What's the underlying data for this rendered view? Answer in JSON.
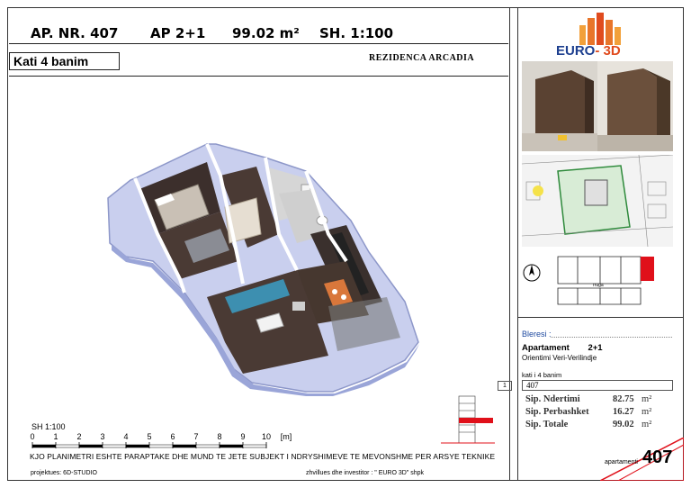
{
  "header": {
    "apartment_no": "AP. NR. 407",
    "type": "AP 2+1",
    "area": "99.02 m²",
    "scale": "SH. 1:100"
  },
  "floor_label": "Kati 4 banim",
  "residence_name": "REZIDENCA ARCADIA",
  "scale_bar": {
    "label": "SH 1:100",
    "ticks": [
      "0",
      "1",
      "2",
      "3",
      "4",
      "5",
      "6",
      "7",
      "8",
      "9",
      "10"
    ],
    "unit": "[m]"
  },
  "disclaimer": "KJO PLANIMETRI ESHTE PARAPTAKE DHE MUND TE JETE SUBJEKT I NDRYSHIMEVE TE MEVONSHME PER ARSYE TEKNIKE",
  "footer": {
    "project": "projektues:  6D-STUDIO",
    "investor": "zhvillues dhe investitor :  \" EURO 3D\" shpk"
  },
  "logo": {
    "part1": "EURO",
    "part2": "- 3D"
  },
  "site_plan_label": "rruga",
  "info": {
    "buyer_label": "Bleresi :",
    "apartment_label": "Apartament",
    "apartment_type": "2+1",
    "orientation": "Orientimi  Veri-Verilindje",
    "floor": "kati i 4 banim",
    "unit_box": "407",
    "small_box": "1",
    "areas": [
      {
        "label": "Sip. Ndertimi",
        "value": "82.75",
        "unit": "m²"
      },
      {
        "label": "Sip. Perbashket",
        "value": "16.27",
        "unit": "m²"
      },
      {
        "label": "Sip. Totale",
        "value": "99.02",
        "unit": "m²"
      }
    ],
    "apartment_word": "apartamenti",
    "apartment_number": "407"
  },
  "colors": {
    "accent_red": "#e0101a",
    "logo_blue": "#1d3f8f",
    "logo_orange": "#e04b1e",
    "wall_blue": "#aab6e6",
    "floor_wood": "#4a3a34",
    "sofa_teal": "#3d8fb0"
  }
}
